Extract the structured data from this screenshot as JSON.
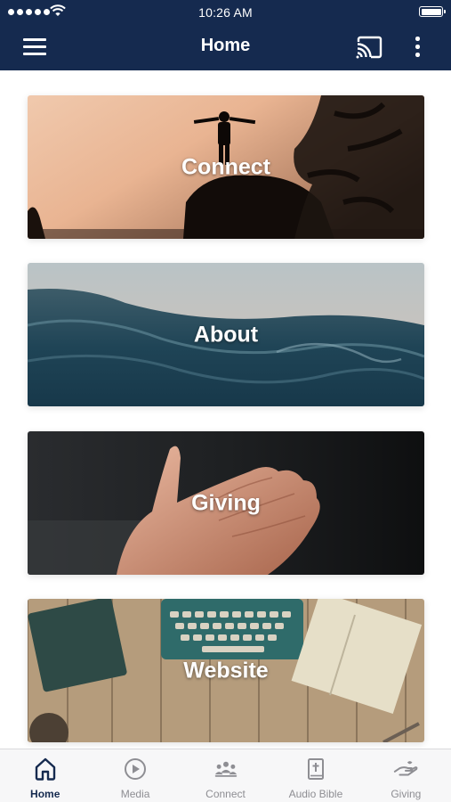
{
  "status_bar": {
    "time": "10:26 AM"
  },
  "nav": {
    "title": "Home"
  },
  "cards": [
    {
      "label": "Connect"
    },
    {
      "label": "About"
    },
    {
      "label": "Giving"
    },
    {
      "label": "Website"
    }
  ],
  "tabs": [
    {
      "label": "Home",
      "icon": "home-icon",
      "active": true
    },
    {
      "label": "Media",
      "icon": "play-icon",
      "active": false
    },
    {
      "label": "Connect",
      "icon": "people-icon",
      "active": false
    },
    {
      "label": "Audio Bible",
      "icon": "bible-icon",
      "active": false
    },
    {
      "label": "Giving",
      "icon": "giving-hand-icon",
      "active": false
    }
  ],
  "colors": {
    "header": "#152a4f",
    "tab_active": "#152a4f",
    "tab_inactive": "#8e8e93"
  }
}
